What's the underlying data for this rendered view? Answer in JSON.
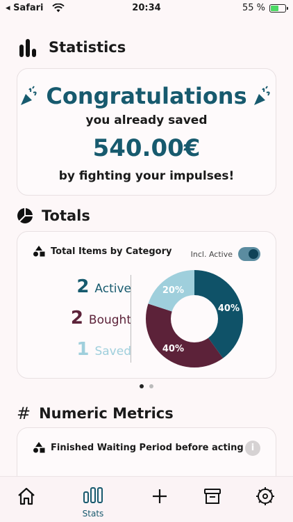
{
  "status_bar": {
    "carrier": "Safari",
    "time": "20:34",
    "battery": "55 %"
  },
  "statistics": {
    "title": "Statistics",
    "icon": "bar-chart-icon",
    "congrats_title": "Congratulations",
    "line1": "you already saved",
    "amount": "540.00€",
    "line2": "by fighting your impulses!"
  },
  "totals": {
    "title": "Totals",
    "icon": "pie-chart-icon",
    "card_title": "Total Items by Category",
    "toggle_label": "Incl. Active",
    "toggle_on": true,
    "legend": [
      {
        "count": "2",
        "label": "Active",
        "color": "#175a6e"
      },
      {
        "count": "2",
        "label": "Bought",
        "color": "#5c2239"
      },
      {
        "count": "1",
        "label": "Saved",
        "color": "#9fcfdc"
      }
    ]
  },
  "chart_data": {
    "type": "pie",
    "categories": [
      "Active",
      "Bought",
      "Saved"
    ],
    "values": [
      40,
      40,
      20
    ],
    "labels": [
      "40%",
      "40%",
      "20%"
    ],
    "colors": [
      "#0f5268",
      "#5c2239",
      "#9fcfdc"
    ]
  },
  "pager": {
    "count": 2,
    "active": 0
  },
  "numeric_metrics": {
    "title": "Numeric Metrics",
    "card_title": "Finished Waiting Period before acting",
    "info": "i"
  },
  "tabs": [
    {
      "name": "home",
      "label": ""
    },
    {
      "name": "stats",
      "label": "Stats"
    },
    {
      "name": "add",
      "label": ""
    },
    {
      "name": "archive",
      "label": ""
    },
    {
      "name": "settings",
      "label": ""
    }
  ],
  "colors": {
    "accent": "#175a6e",
    "background": "#fdf7f8"
  }
}
